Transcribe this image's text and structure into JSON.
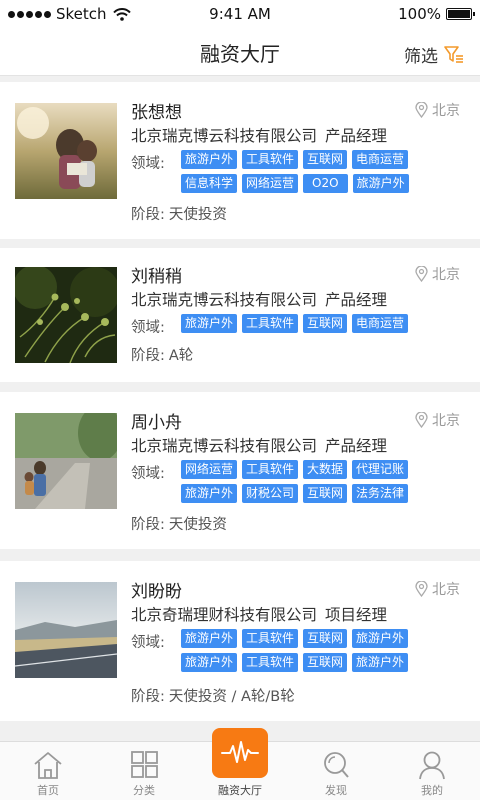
{
  "status": {
    "carrier": "Sketch",
    "time": "9:41 AM",
    "battery": "100%"
  },
  "nav": {
    "title": "融资大厅",
    "filter_label": "筛选"
  },
  "field_label": "领域:",
  "stage_label": "阶段:",
  "cards": [
    {
      "name": "张想想",
      "location": "北京",
      "company": "北京瑞克博云科技有限公司",
      "role": "产品经理",
      "tags": [
        "旅游户外",
        "工具软件",
        "互联网",
        "电商运营",
        "信息科学",
        "网络运营",
        "O2O",
        "旅游户外"
      ],
      "stage": "天使投资"
    },
    {
      "name": "刘稍稍",
      "location": "北京",
      "company": "北京瑞克博云科技有限公司",
      "role": "产品经理",
      "tags": [
        "旅游户外",
        "工具软件",
        "互联网",
        "电商运营"
      ],
      "stage": "A轮"
    },
    {
      "name": "周小舟",
      "location": "北京",
      "company": "北京瑞克博云科技有限公司",
      "role": "产品经理",
      "tags": [
        "网络运营",
        "工具软件",
        "大数据",
        "代理记账",
        "旅游户外",
        "财税公司",
        "互联网",
        "法务法律"
      ],
      "stage": "天使投资"
    },
    {
      "name": "刘盼盼",
      "location": "北京",
      "company": "北京奇瑞理财科技有限公司",
      "role": "项目经理",
      "tags": [
        "旅游户外",
        "工具软件",
        "互联网",
        "旅游户外",
        "旅游户外",
        "工具软件",
        "互联网",
        "旅游户外"
      ],
      "stage": "天使投资 / A轮/B轮"
    }
  ],
  "tabs": [
    {
      "label": "首页",
      "icon": "home-icon"
    },
    {
      "label": "分类",
      "icon": "category-icon"
    },
    {
      "label": "融资大厅",
      "icon": "pulse-icon"
    },
    {
      "label": "发现",
      "icon": "discover-icon"
    },
    {
      "label": "我的",
      "icon": "profile-icon"
    }
  ],
  "colors": {
    "accent": "#f77a13",
    "tag": "#3e8ef3",
    "filter_icon": "#f39a2c"
  }
}
